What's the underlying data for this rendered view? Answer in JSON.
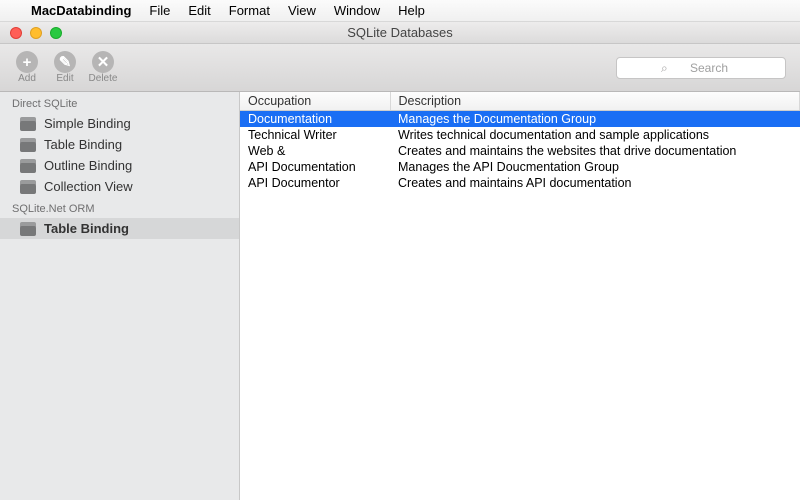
{
  "menubar": {
    "apple_icon": "",
    "app_name": "MacDatabinding",
    "items": [
      "File",
      "Edit",
      "Format",
      "View",
      "Window",
      "Help"
    ]
  },
  "window": {
    "title": "SQLite Databases"
  },
  "toolbar": {
    "buttons": [
      {
        "glyph": "+",
        "label": "Add"
      },
      {
        "glyph": "✎",
        "label": "Edit"
      },
      {
        "glyph": "✕",
        "label": "Delete"
      }
    ],
    "search_placeholder": "Search"
  },
  "sidebar": {
    "groups": [
      {
        "header": "Direct SQLite",
        "items": [
          {
            "label": "Simple Binding",
            "selected": false
          },
          {
            "label": "Table Binding",
            "selected": false
          },
          {
            "label": "Outline Binding",
            "selected": false
          },
          {
            "label": "Collection View",
            "selected": false
          }
        ]
      },
      {
        "header": "SQLite.Net ORM",
        "items": [
          {
            "label": "Table Binding",
            "selected": true
          }
        ]
      }
    ]
  },
  "table": {
    "columns": [
      "Occupation",
      "Description"
    ],
    "rows": [
      {
        "occupation": "Documentation",
        "description": "Manages the Documentation Group",
        "selected": true
      },
      {
        "occupation": "Technical Writer",
        "description": "Writes technical documentation and sample applications",
        "selected": false
      },
      {
        "occupation": "Web &",
        "description": "Creates and maintains the websites that drive documentation",
        "selected": false
      },
      {
        "occupation": "API Documentation",
        "description": "Manages the API Doucmentation Group",
        "selected": false
      },
      {
        "occupation": "API Documentor",
        "description": "Creates and maintains API documentation",
        "selected": false
      }
    ]
  }
}
